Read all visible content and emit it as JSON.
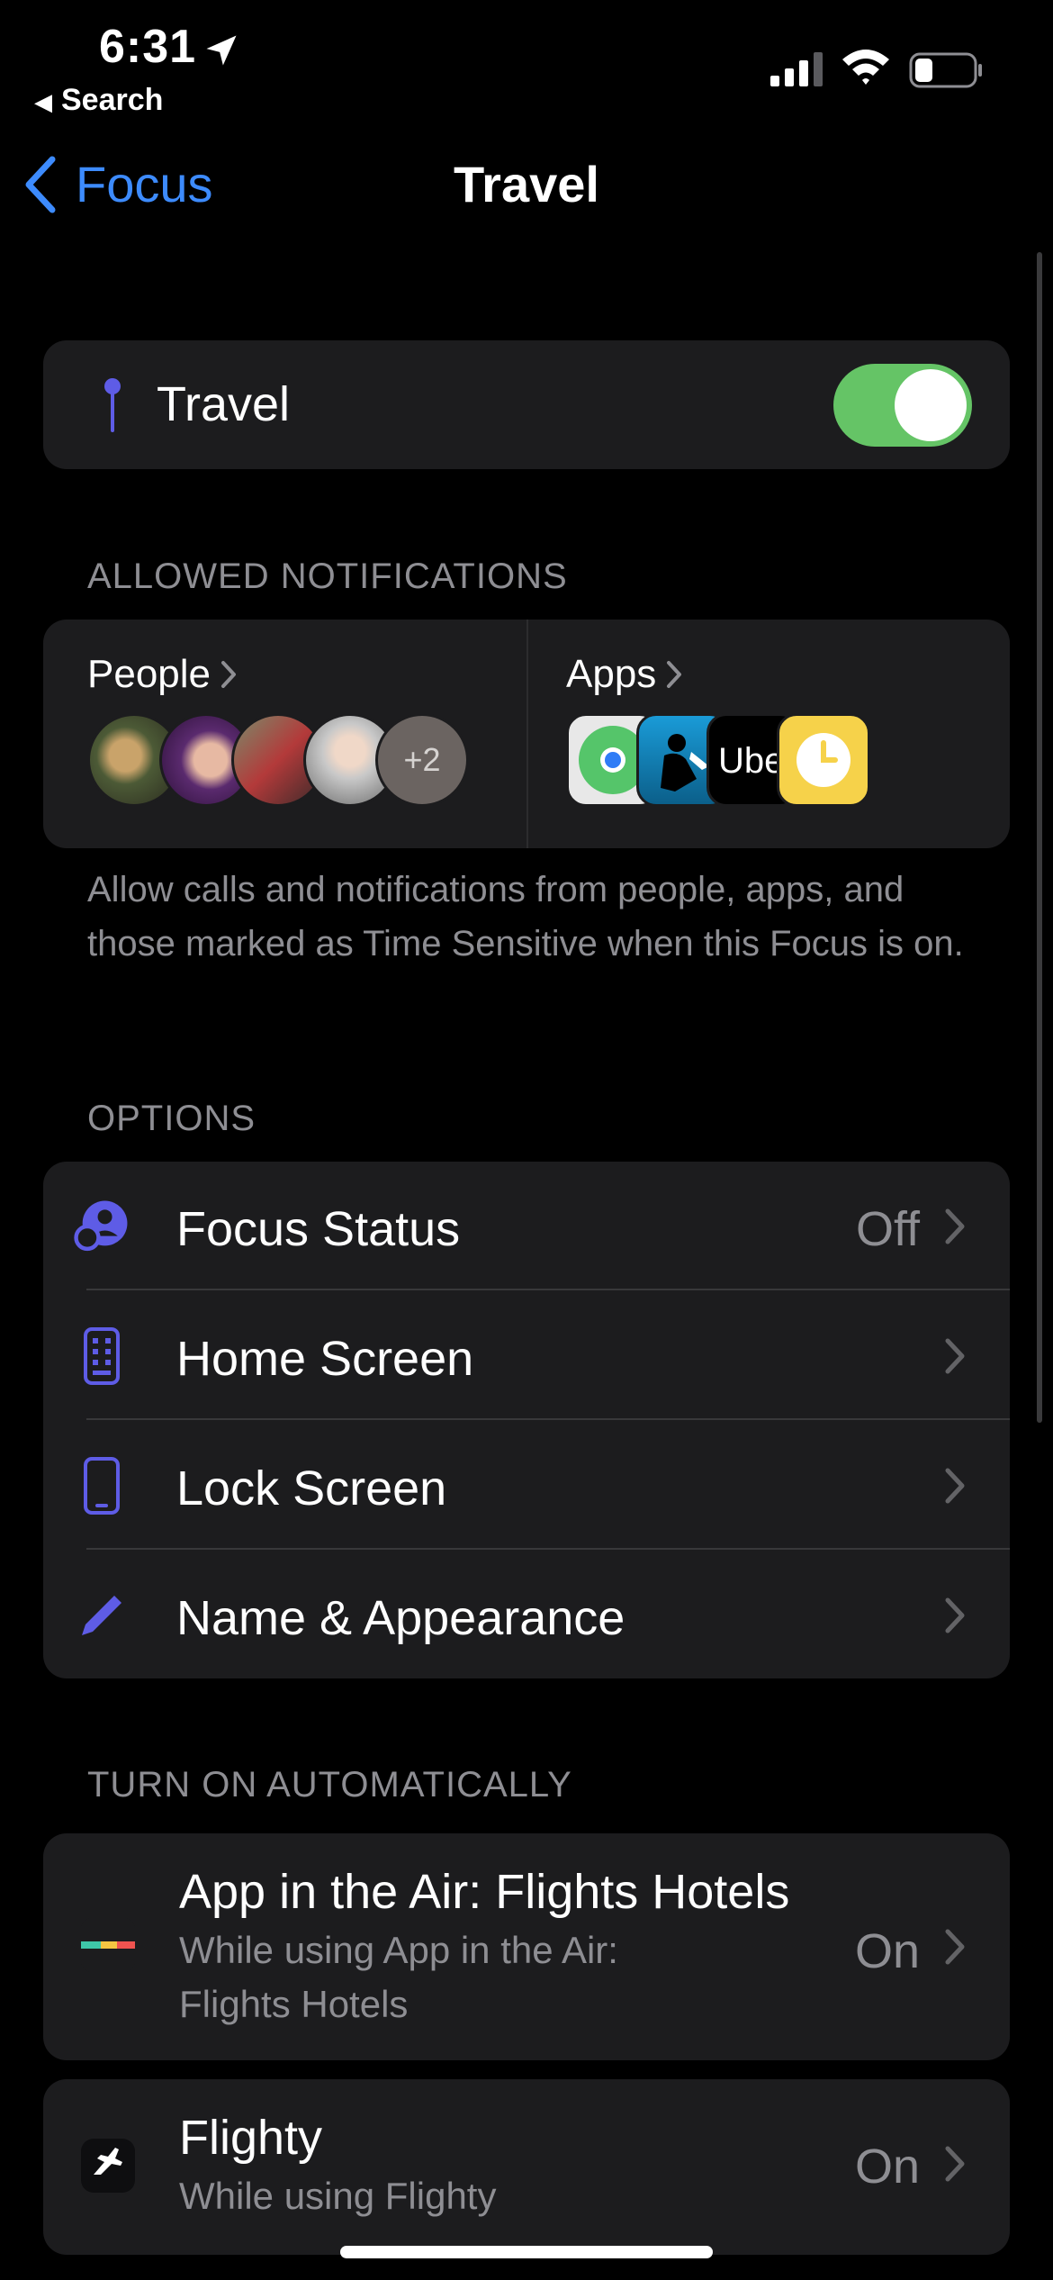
{
  "status_bar": {
    "time": "6:31",
    "back_app": "Search",
    "battery_level": 0.3
  },
  "nav": {
    "back_label": "Focus",
    "title": "Travel"
  },
  "focus_toggle": {
    "label": "Travel",
    "enabled": true
  },
  "allowed_notifications": {
    "header": "ALLOWED NOTIFICATIONS",
    "people_label": "People",
    "people_more": "+2",
    "apps_label": "Apps",
    "app_icons": [
      "find-my-icon",
      "kindle-icon",
      "uber-icon",
      "clock-icon"
    ],
    "uber_text": "Uber",
    "footer": "Allow calls and notifications from people, apps, and those marked as Time Sensitive when this Focus is on."
  },
  "options": {
    "header": "OPTIONS",
    "items": [
      {
        "label": "Focus Status",
        "value": "Off",
        "icon": "focus-status-icon"
      },
      {
        "label": "Home Screen",
        "value": "",
        "icon": "home-screen-icon"
      },
      {
        "label": "Lock Screen",
        "value": "",
        "icon": "lock-screen-icon"
      },
      {
        "label": "Name & Appearance",
        "value": "",
        "icon": "pencil-icon"
      }
    ]
  },
  "turn_on_automatically": {
    "header": "TURN ON AUTOMATICALLY",
    "items": [
      {
        "title": "App in the Air: Flights Hotels",
        "subtitle_line1": "While using App in the Air:",
        "subtitle_line2": "Flights Hotels",
        "value": "On"
      },
      {
        "title": "Flighty",
        "subtitle_line1": "While using Flighty",
        "value": "On"
      }
    ]
  },
  "colors": {
    "accent": "#3d8bfd",
    "toggle_on": "#65c466",
    "icon_purple": "#5e5ce6",
    "card_bg": "#1c1c1e"
  }
}
